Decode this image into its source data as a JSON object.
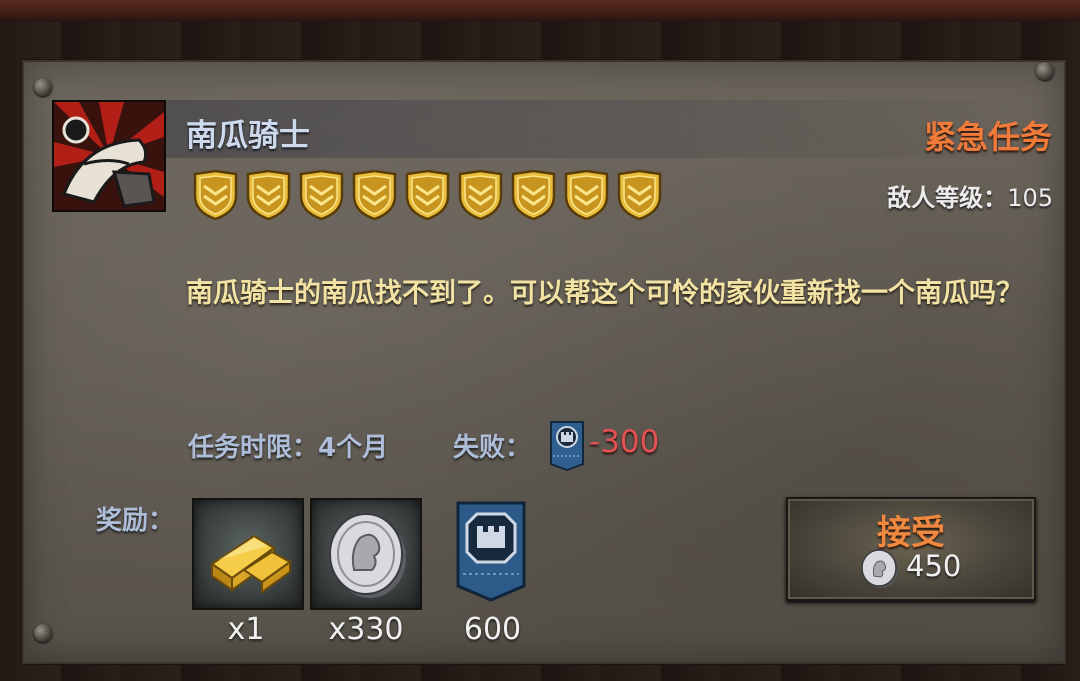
{
  "quest": {
    "name": "南瓜骑士",
    "type_label": "紧急任务",
    "enemy_level_label": "敌人等级：",
    "enemy_level_value": "105",
    "difficulty_shields": 9,
    "description": "南瓜骑士的南瓜找不到了。可以帮这个可怜的家伙重新找一个南瓜吗？",
    "time_limit_label": "任务时限：",
    "time_limit_value": "4个月",
    "failure_label": "失败：",
    "failure_value": "-300",
    "failure_icon": "fortress-banner-icon"
  },
  "rewards": {
    "label": "奖励：",
    "items": [
      {
        "icon": "gold-bars-icon",
        "quantity": "x1"
      },
      {
        "icon": "silver-coin-icon",
        "quantity": "x330"
      },
      {
        "icon": "fortress-banner-icon",
        "quantity": "600"
      }
    ]
  },
  "accept_button": {
    "label": "接受",
    "cost": "450",
    "cost_icon": "silver-coin-icon"
  },
  "colors": {
    "title": "#cdd9ec",
    "urgent": "#f07a3a",
    "description": "#f2e3a5",
    "label_blue": "#aebdd8",
    "failure_red": "#e35252",
    "shield_gold": "#d9a92a"
  }
}
